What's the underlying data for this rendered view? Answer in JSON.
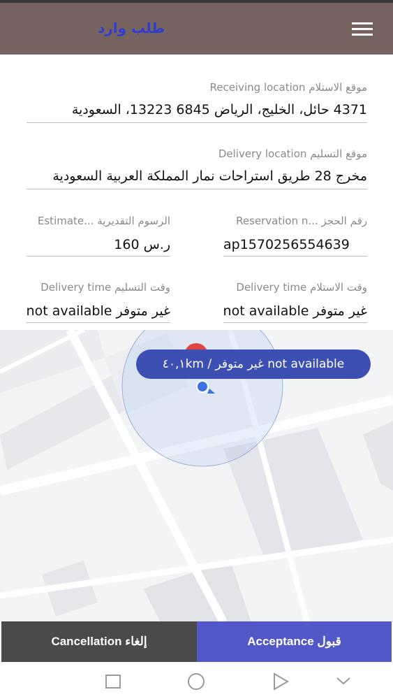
{
  "header": {
    "title": "طلب وارد"
  },
  "fields": {
    "receiving_location": {
      "label": "Receiving location موقع الاستلام",
      "value": "4371 حائل، الخليج، الرياض 6845 13223، السعودية"
    },
    "delivery_location": {
      "label": "Delivery location موقع التسليم",
      "value": "مخرج 28 طريق استراحات نمار المملكة العربية السعودية"
    },
    "reservation": {
      "label": "Reservation n... رقم الحجز",
      "value": "ap1570256554639"
    },
    "estimate": {
      "label": "Estimate... الرسوم التقديرية",
      "value": "ر.س 160"
    },
    "receiving_time": {
      "label": "Delivery time وقت الاستلام",
      "value": "غير متوفر not available"
    },
    "delivery_time": {
      "label": "Delivery time وقت التسليم",
      "value": "غير متوفر not available"
    }
  },
  "map": {
    "distance_label": "٤٠,١km / غير متوفر not available"
  },
  "actions": {
    "cancel_label": "Cancellation إلغاء",
    "accept_label": "Acceptance قبول"
  },
  "colors": {
    "appbar": "#76635f",
    "title": "#2f3ccf",
    "accent": "#3e4fb3",
    "accept_button": "#5358c9",
    "cancel_button": "#4a4a4a"
  }
}
